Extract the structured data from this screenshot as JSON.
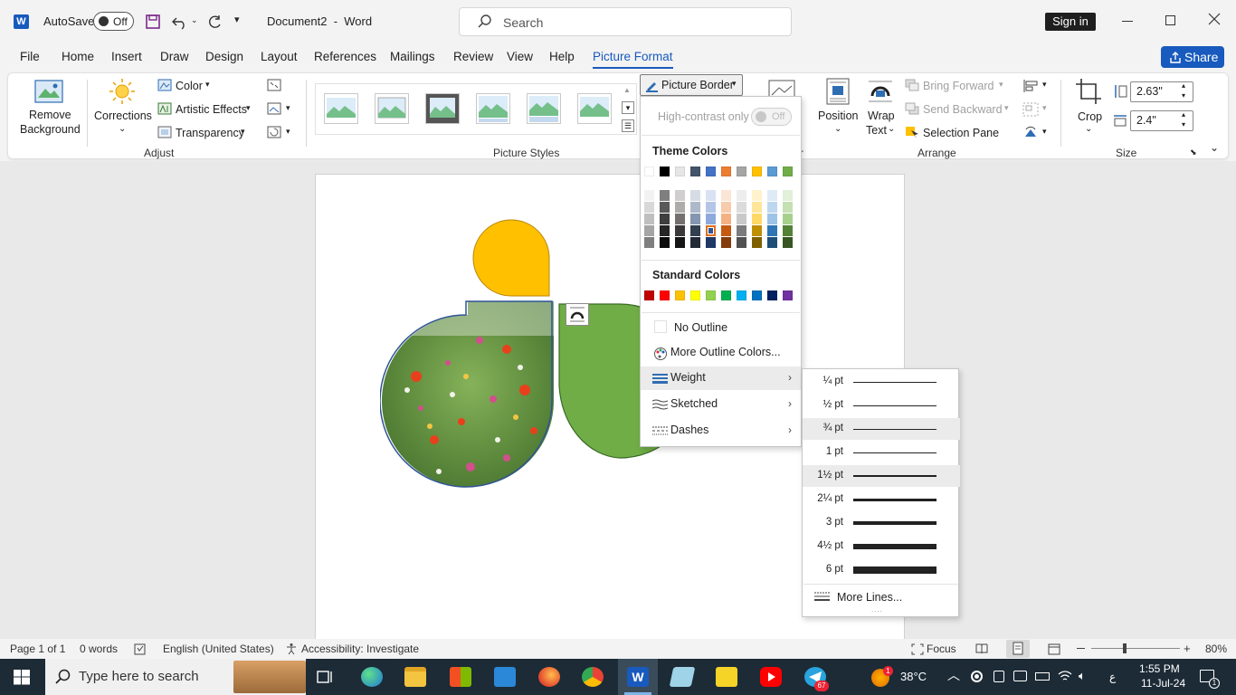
{
  "titlebar": {
    "autosave_label": "AutoSave",
    "autosave_state": "Off",
    "doc_title": "Document2  -  Word",
    "search_placeholder": "Search",
    "signin_label": "Sign in"
  },
  "tabs": [
    "File",
    "Home",
    "Insert",
    "Draw",
    "Design",
    "Layout",
    "References",
    "Mailings",
    "Review",
    "View",
    "Help",
    "Picture Format"
  ],
  "active_tab": "Picture Format",
  "share_label": "Share",
  "ribbon": {
    "remove_background": [
      "Remove",
      "Background"
    ],
    "corrections": "Corrections",
    "color": "Color",
    "artistic_effects": "Artistic Effects",
    "transparency": "Transparency",
    "adjust_group": "Adjust",
    "picture_styles_group": "Picture Styles",
    "picture_border": "Picture Border",
    "position": "Position",
    "wrap_text": [
      "Wrap",
      "Text"
    ],
    "bring_forward": "Bring Forward",
    "send_backward": "Send Backward",
    "selection_pane": "Selection Pane",
    "arrange_group": "Arrange",
    "crop": "Crop",
    "height_value": "2.63\"",
    "width_value": "2.4\"",
    "size_group": "Size"
  },
  "dropdown": {
    "high_contrast_label": "High-contrast only",
    "high_contrast_state": "Off",
    "theme_colors_header": "Theme Colors",
    "standard_colors_header": "Standard Colors",
    "no_outline": "No Outline",
    "more_outline_colors": "More Outline Colors...",
    "weight": "Weight",
    "sketched": "Sketched",
    "dashes": "Dashes",
    "theme_top": [
      "#ffffff",
      "#000000",
      "#e7e6e6",
      "#44546a",
      "#4472c4",
      "#ed7d31",
      "#a5a5a5",
      "#ffc000",
      "#5b9bd5",
      "#70ad47"
    ],
    "theme_shades": [
      [
        "#f2f2f2",
        "#7f7f7f",
        "#d0cece",
        "#d6dce4",
        "#d9e2f3",
        "#fbe5d5",
        "#ededed",
        "#fff2cc",
        "#deebf6",
        "#e2efd9"
      ],
      [
        "#d8d8d8",
        "#595959",
        "#aeabab",
        "#adb9ca",
        "#b4c6e7",
        "#f7cbac",
        "#dbdbdb",
        "#fee599",
        "#bdd7ee",
        "#c5e0b3"
      ],
      [
        "#bfbfbf",
        "#3f3f3f",
        "#757070",
        "#8496b0",
        "#8eaadb",
        "#f4b183",
        "#c9c9c9",
        "#ffd966",
        "#9dc3e6",
        "#a8d08d"
      ],
      [
        "#a5a5a5",
        "#262626",
        "#3a3838",
        "#323f4f",
        "#2f5496",
        "#c55a11",
        "#7b7b7b",
        "#bf8f00",
        "#2e75b5",
        "#538135"
      ],
      [
        "#7f7f7f",
        "#0c0c0c",
        "#171616",
        "#222a35",
        "#1f3864",
        "#833c0b",
        "#525252",
        "#7f6000",
        "#1f4e79",
        "#375623"
      ]
    ],
    "standard": [
      "#c00000",
      "#ff0000",
      "#ffc000",
      "#ffff00",
      "#92d050",
      "#00b050",
      "#00b0f0",
      "#0070c0",
      "#002060",
      "#7030a0"
    ]
  },
  "weights": [
    {
      "label": "¼ pt",
      "value": 0.25
    },
    {
      "label": "½ pt",
      "value": 0.5
    },
    {
      "label": "¾ pt",
      "value": 0.75
    },
    {
      "label": "1 pt",
      "value": 1
    },
    {
      "label": "1½ pt",
      "value": 1.5
    },
    {
      "label": "2¼ pt",
      "value": 2.25
    },
    {
      "label": "3 pt",
      "value": 3
    },
    {
      "label": "4½ pt",
      "value": 4.5
    },
    {
      "label": "6 pt",
      "value": 6
    }
  ],
  "more_lines": "More Lines...",
  "status": {
    "page": "Page 1 of 1",
    "words": "0 words",
    "language": "English (United States)",
    "accessibility": "Accessibility: Investigate",
    "focus": "Focus",
    "zoom": "80%"
  },
  "taskbar": {
    "search_placeholder": "Type here to search",
    "temperature": "38°C",
    "time": "1:55 PM",
    "date": "11-Jul-24",
    "telegram_badge": "67",
    "weather_badge": "1",
    "notif_badge": "1",
    "ime_char": "ع"
  }
}
